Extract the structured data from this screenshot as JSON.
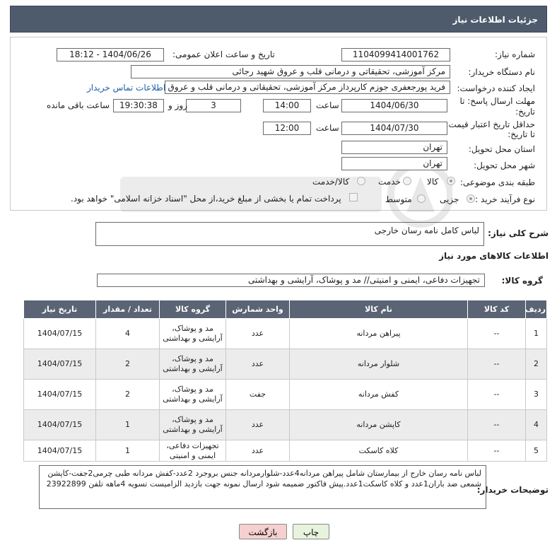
{
  "header": {
    "title": "جزئیات اطلاعات نیاز"
  },
  "form": {
    "need_number": {
      "label": "شماره نیاز:",
      "value": "1104099414001762"
    },
    "announce": {
      "label": "تاریخ و ساعت اعلان عمومی:",
      "value": "1404/06/26 - 18:12"
    },
    "buyer": {
      "label": "نام دستگاه خریدار:",
      "value": "مرکز آموزشی، تحقیقاتی و درمانی قلب و عروق شهید رجائی"
    },
    "creator": {
      "label": "ایجاد کننده درخواست:",
      "value": "فرید پورجعفری جوزم کارپرداز  مرکز آموزشی، تحقیقاتی و درمانی قلب و عروق شهید رجائی",
      "contact_link": "اطلاعات تماس خریدار"
    },
    "deadline": {
      "label_line1": "مهلت ارسال پاسخ: تا",
      "label_line2": "تاریخ:",
      "date": "1404/06/30",
      "time_label": "ساعت",
      "time": "14:00",
      "days": "3",
      "days_label": "روز و",
      "remaining": "19:30:38",
      "remaining_label": "ساعت باقی مانده"
    },
    "validity": {
      "label_line1": "حداقل تاریخ اعتبار قیمت:",
      "label_line2": "تا تاریخ:",
      "date": "1404/07/30",
      "time_label": "ساعت",
      "time": "12:00"
    },
    "province": {
      "label": "استان محل تحویل:",
      "value": "تهران"
    },
    "city": {
      "label": "شهر محل تحویل:",
      "value": "تهران"
    },
    "category": {
      "label": "طبقه بندی موضوعی:",
      "options": [
        "کالا",
        "خدمت",
        "کالا/خدمت"
      ],
      "selected": "کالا"
    },
    "process": {
      "label": "نوع فرآیند خرید :",
      "options": [
        "جزیی",
        "متوسط"
      ],
      "selected": "جزیی",
      "payment_note": "پرداخت تمام یا بخشی از مبلغ خرید،از محل \"اسناد خزانه اسلامی\" خواهد بود."
    }
  },
  "description": {
    "label": "شرح کلی نیاز:",
    "value": "لباس کامل نامه رسان خارجی"
  },
  "goods_info": {
    "section_title": "اطلاعات کالاهای مورد نیاز",
    "group_label": "گروه کالا:",
    "group_value": "تجهیزات دفاعی، ایمنی و امنیتی// مد و پوشاک، آرایشی و بهداشتی"
  },
  "table": {
    "headers": [
      "ردیف",
      "کد کالا",
      "نام کالا",
      "واحد شمارش",
      "گروه کالا",
      "تعداد / مقدار",
      "تاریخ نیاز"
    ],
    "rows": [
      {
        "index": "1",
        "code": "--",
        "name": "پیراهن مردانه",
        "unit": "عدد",
        "group": "مد و پوشاک، آرایشی و بهداشتی",
        "qty": "4",
        "date": "1404/07/15"
      },
      {
        "index": "2",
        "code": "--",
        "name": "شلوار مردانه",
        "unit": "عدد",
        "group": "مد و پوشاک، آرایشی و بهداشتی",
        "qty": "2",
        "date": "1404/07/15"
      },
      {
        "index": "3",
        "code": "--",
        "name": "کفش مردانه",
        "unit": "جفت",
        "group": "مد و پوشاک، آرایشی و بهداشتی",
        "qty": "2",
        "date": "1404/07/15"
      },
      {
        "index": "4",
        "code": "--",
        "name": "کاپشن مردانه",
        "unit": "عدد",
        "group": "مد و پوشاک، آرایشی و بهداشتی",
        "qty": "1",
        "date": "1404/07/15"
      },
      {
        "index": "5",
        "code": "--",
        "name": "کلاه کاسکت",
        "unit": "عدد",
        "group": "تجهیزات دفاعی، ایمنی و امنیتی",
        "qty": "1",
        "date": "1404/07/15"
      }
    ]
  },
  "buyer_notes": {
    "label": "توضیحات خریدار:",
    "value": "لباس نامه رسان خارج از بیمارستان شامل پیراهن مردانه4عدد-شلوارمردانه جنس بروجرد 2عدد-کفش مردانه طبی چرمی2جفت-کاپشن شمعی ضد باران1عدد و کلاه کاسکت1عدد.پیش فاکتور ضمیمه شود ارسال نمونه جهت بازدید الزامیست تسویه 4ماهه تلفن 23922899"
  },
  "buttons": {
    "print": "چاپ",
    "back": "بازگشت"
  },
  "colors": {
    "header_bg": "#4e5b6d",
    "table_header_bg": "#5b6474",
    "link": "#1c5fa7",
    "back_button": "#f6d0d0",
    "print_button": "#e8f3de"
  }
}
